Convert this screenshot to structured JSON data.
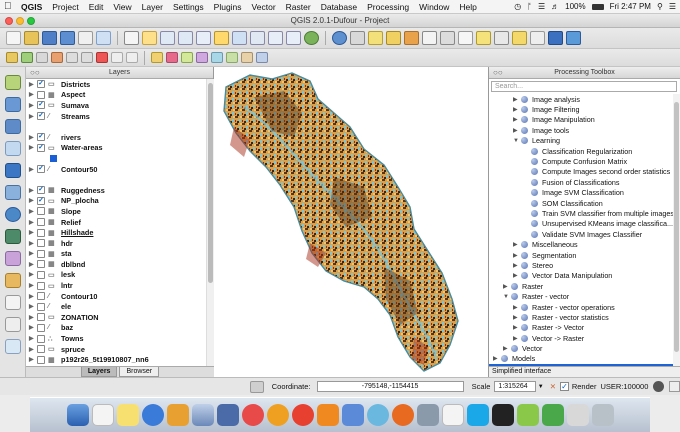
{
  "menubar": {
    "app": "QGIS",
    "items": [
      "Project",
      "Edit",
      "View",
      "Layer",
      "Settings",
      "Plugins",
      "Vector",
      "Raster",
      "Database",
      "Processing",
      "Window",
      "Help"
    ],
    "battery": "100%",
    "clock": "Fri 2:47 PM"
  },
  "window": {
    "title": "QGIS 2.0.1-Dufour - Project"
  },
  "layers_panel": {
    "title": "Layers",
    "tabs": [
      "Layers",
      "Browser"
    ],
    "items": [
      {
        "label": "Districts",
        "checked": true,
        "bold": true,
        "icon": "vector-polygon-icon"
      },
      {
        "label": "Aspect",
        "checked": false,
        "bold": true,
        "icon": "raster-icon"
      },
      {
        "label": "Sumava",
        "checked": true,
        "bold": true,
        "icon": "vector-polygon-icon"
      },
      {
        "label": "Streams",
        "checked": true,
        "bold": true,
        "icon": "vector-line-icon"
      },
      {
        "label": "",
        "checked": null,
        "bold": false,
        "icon": "",
        "spacer": true
      },
      {
        "label": "rivers",
        "checked": true,
        "bold": true,
        "icon": "vector-line-icon"
      },
      {
        "label": "Water-areas",
        "checked": true,
        "bold": true,
        "icon": "vector-polygon-icon"
      },
      {
        "label": "",
        "checked": null,
        "bold": false,
        "icon": "",
        "swatch": true
      },
      {
        "label": "Contour50",
        "checked": true,
        "bold": true,
        "icon": "vector-line-icon"
      },
      {
        "label": "",
        "checked": null,
        "bold": false,
        "icon": "",
        "spacer": true
      },
      {
        "label": "Ruggedness",
        "checked": true,
        "bold": true,
        "icon": "raster-icon"
      },
      {
        "label": "NP_plocha",
        "checked": true,
        "bold": true,
        "icon": "vector-polygon-icon"
      },
      {
        "label": "Slope",
        "checked": false,
        "bold": true,
        "icon": "raster-icon"
      },
      {
        "label": "Relief",
        "checked": false,
        "bold": true,
        "icon": "raster-icon"
      },
      {
        "label": "Hillshade",
        "checked": false,
        "bold": true,
        "icon": "raster-icon",
        "underline": true
      },
      {
        "label": "hdr",
        "checked": false,
        "bold": true,
        "icon": "raster-icon"
      },
      {
        "label": "sta",
        "checked": false,
        "bold": true,
        "icon": "raster-icon"
      },
      {
        "label": "dblbnd",
        "checked": false,
        "bold": true,
        "icon": "raster-icon"
      },
      {
        "label": "lesk",
        "checked": false,
        "bold": true,
        "icon": "vector-polygon-icon"
      },
      {
        "label": "lntr",
        "checked": false,
        "bold": true,
        "icon": "vector-polygon-icon"
      },
      {
        "label": "Contour10",
        "checked": false,
        "bold": true,
        "icon": "vector-line-icon"
      },
      {
        "label": "ele",
        "checked": false,
        "bold": true,
        "icon": "vector-line-icon"
      },
      {
        "label": "ZONATION",
        "checked": false,
        "bold": true,
        "icon": "vector-polygon-icon"
      },
      {
        "label": "baz",
        "checked": false,
        "bold": true,
        "icon": "vector-line-icon"
      },
      {
        "label": "Towns",
        "checked": false,
        "bold": true,
        "icon": "vector-point-icon"
      },
      {
        "label": "spruce",
        "checked": false,
        "bold": true,
        "icon": "vector-polygon-icon"
      },
      {
        "label": "p192r26_5t19910807_nn6",
        "checked": false,
        "bold": true,
        "icon": "raster-icon"
      }
    ]
  },
  "toolbox": {
    "title": "Processing Toolbox",
    "search_placeholder": "Search...",
    "footer": "Simplified interface",
    "items": [
      {
        "label": "Image analysis",
        "level": 2,
        "arrow": "▶"
      },
      {
        "label": "Image Filtering",
        "level": 2,
        "arrow": "▶"
      },
      {
        "label": "Image Manipulation",
        "level": 2,
        "arrow": "▶"
      },
      {
        "label": "Image tools",
        "level": 2,
        "arrow": "▶"
      },
      {
        "label": "Learning",
        "level": 2,
        "arrow": "▼"
      },
      {
        "label": "Classification Regularization",
        "level": 3,
        "arrow": ""
      },
      {
        "label": "Compute Confusion Matrix",
        "level": 3,
        "arrow": ""
      },
      {
        "label": "Compute Images second order statistics",
        "level": 3,
        "arrow": ""
      },
      {
        "label": "Fusion of Classifications",
        "level": 3,
        "arrow": ""
      },
      {
        "label": "Image SVM Classification",
        "level": 3,
        "arrow": ""
      },
      {
        "label": "SOM Classification",
        "level": 3,
        "arrow": ""
      },
      {
        "label": "Train SVM classifier from multiple images",
        "level": 3,
        "arrow": ""
      },
      {
        "label": "Unsupervised KMeans image classifica...",
        "level": 3,
        "arrow": ""
      },
      {
        "label": "Validate SVM Images Classifier",
        "level": 3,
        "arrow": ""
      },
      {
        "label": "Miscellaneous",
        "level": 2,
        "arrow": "▶"
      },
      {
        "label": "Segmentation",
        "level": 2,
        "arrow": "▶"
      },
      {
        "label": "Stereo",
        "level": 2,
        "arrow": "▶"
      },
      {
        "label": "Vector Data Manipulation",
        "level": 2,
        "arrow": "▶"
      },
      {
        "label": "Raster",
        "level": 1,
        "arrow": "▶"
      },
      {
        "label": "Raster - vector",
        "level": 1,
        "arrow": "▼"
      },
      {
        "label": "Raster - vector operations",
        "level": 2,
        "arrow": "▶"
      },
      {
        "label": "Raster - vector statistics",
        "level": 2,
        "arrow": "▶"
      },
      {
        "label": "Raster -> Vector",
        "level": 2,
        "arrow": "▶"
      },
      {
        "label": "Vector -> Raster",
        "level": 2,
        "arrow": "▶"
      },
      {
        "label": "Vector",
        "level": 1,
        "arrow": "▶"
      },
      {
        "label": "Models",
        "level": 0,
        "arrow": "▶"
      },
      {
        "label": "Scripts",
        "level": 0,
        "arrow": "▶",
        "selected": true
      }
    ]
  },
  "statusbar": {
    "coord_label": "Coordinate:",
    "coord_value": "-795148,-1154415",
    "scale_label": "Scale",
    "scale_value": "1:315264",
    "render_label": "Render",
    "crs": "USER:100000"
  },
  "colors": {
    "selection": "#1d63d6",
    "map_fill": "#d9a24a",
    "map_water": "#7ec6d6",
    "map_dark": "#5a3418"
  }
}
